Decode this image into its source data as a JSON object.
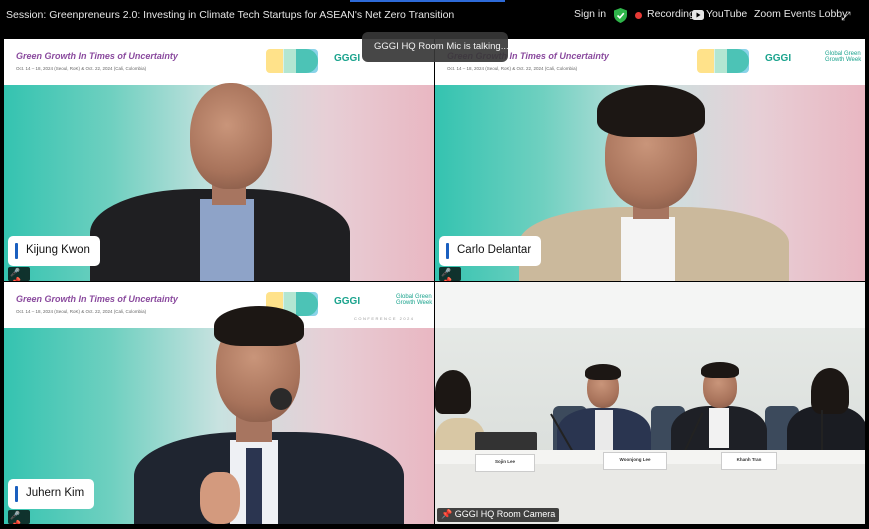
{
  "topbar": {
    "session_title": "Session: Greenpreneurs 2.0: Investing in Climate Tech Startups for ASEAN's Net Zero Transition",
    "sign_in": "Sign in",
    "recording": "Recording",
    "youtube": "YouTube",
    "zoom_lobby": "Zoom Events Lobby",
    "accent_color": "#2d6ad8",
    "recording_color": "#e53935"
  },
  "talking_notice": "GGGI HQ Room Mic is talking...",
  "banner": {
    "title": "Green Growth In Times of Uncertainty",
    "subtitle": "Oct. 14 – 18, 2024 (Seoul, RoK) & Oct. 22, 2024 (Cali, Colombia)",
    "gggi": "GGGI",
    "gggw": "Global Green Growth Week",
    "conference": "CONFERENCE 2024"
  },
  "participants": [
    {
      "name": "Kijung Kwon",
      "muted": true
    },
    {
      "name": "Carlo Delantar",
      "muted": true
    },
    {
      "name": "Juhern Kim",
      "muted": true
    }
  ],
  "room": {
    "label": "GGGI HQ Room Camera",
    "placards": [
      "Sojin Lee",
      "Woonjong Lee",
      "Khanh Tran",
      ""
    ]
  },
  "icons": {
    "mic_muted": "mic-muted-icon",
    "shield": "shield-check-icon",
    "youtube": "youtube-icon",
    "expand": "expand-icon",
    "pin": "pin-icon"
  }
}
